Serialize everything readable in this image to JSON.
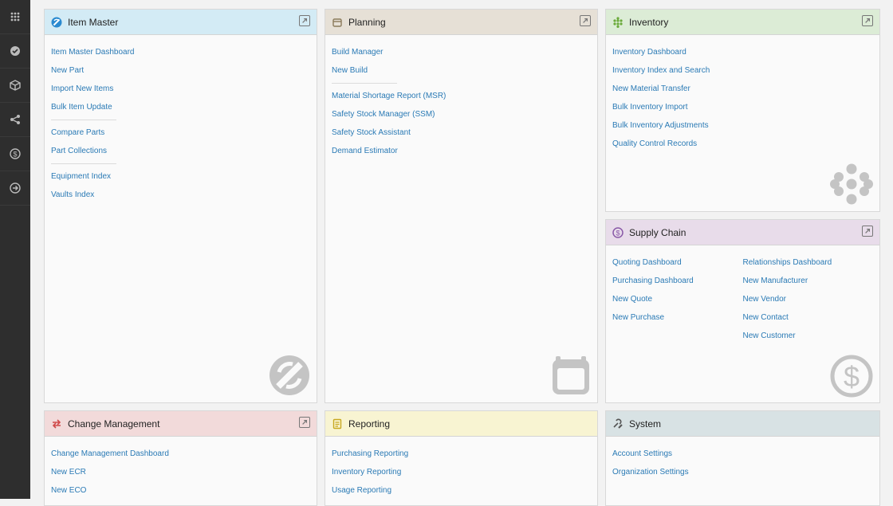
{
  "sidebar": {
    "items": [
      {
        "icon": "grid-dots-icon"
      },
      {
        "icon": "badge-icon"
      },
      {
        "icon": "cube-icon"
      },
      {
        "icon": "share-icon"
      },
      {
        "icon": "dollar-icon"
      },
      {
        "icon": "arrow-right-icon"
      }
    ]
  },
  "panels": {
    "item_master": {
      "title": "Item Master",
      "color": "#d3ebf5",
      "groups": [
        [
          "Item Master Dashboard",
          "New Part",
          "Import New Items",
          "Bulk Item Update"
        ],
        [
          "Compare Parts",
          "Part Collections"
        ],
        [
          "Equipment Index",
          "Vaults Index"
        ]
      ]
    },
    "planning": {
      "title": "Planning",
      "color": "#e6e0d6",
      "groups": [
        [
          "Build Manager",
          "New Build"
        ],
        [
          "Material Shortage Report (MSR)",
          "Safety Stock Manager (SSM)",
          "Safety Stock Assistant",
          "Demand Estimator"
        ]
      ]
    },
    "inventory": {
      "title": "Inventory",
      "color": "#dcecd6",
      "links": [
        "Inventory Dashboard",
        "Inventory Index and Search",
        "New Material Transfer",
        "Bulk Inventory Import",
        "Bulk Inventory Adjustments",
        "Quality Control Records"
      ]
    },
    "supply_chain": {
      "title": "Supply Chain",
      "color": "#e8dcea",
      "col1": [
        "Quoting Dashboard",
        "Purchasing Dashboard",
        "New Quote",
        "New Purchase"
      ],
      "col2": [
        "Relationships Dashboard",
        "New Manufacturer",
        "New Vendor",
        "New Contact",
        "New Customer"
      ]
    },
    "change_management": {
      "title": "Change Management",
      "color": "#f2dada",
      "links": [
        "Change Management Dashboard",
        "New ECR",
        "New ECO"
      ]
    },
    "reporting": {
      "title": "Reporting",
      "color": "#f8f4d2",
      "links": [
        "Purchasing Reporting",
        "Inventory Reporting",
        "Usage Reporting"
      ]
    },
    "system": {
      "title": "System",
      "color": "#d8e2e4",
      "links": [
        "Account Settings",
        "Organization Settings"
      ]
    }
  },
  "colors": {
    "link": "#2a7ab5",
    "sidebar_bg": "#2e2e2e",
    "watermark": "#c4c4c4"
  }
}
